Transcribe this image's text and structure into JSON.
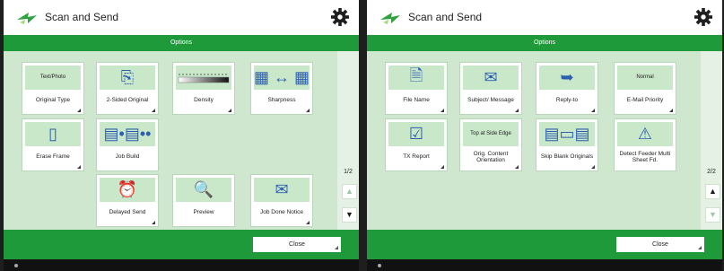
{
  "left": {
    "title": "Scan and Send",
    "options_label": "Options",
    "page": "1/2",
    "close_label": "Close",
    "tiles": [
      {
        "label": "Original Type",
        "icon_text": "Text/Photo"
      },
      {
        "label": "2-Sided Original",
        "icon_text": ""
      },
      {
        "label": "Density",
        "icon_text": ""
      },
      {
        "label": "Sharpness",
        "icon_text": ""
      },
      {
        "label": "Erase Frame",
        "icon_text": ""
      },
      {
        "label": "Job Build",
        "icon_text": ""
      },
      {
        "label": "Delayed Send",
        "icon_text": ""
      },
      {
        "label": "Preview",
        "icon_text": ""
      },
      {
        "label": "Job Done Notice",
        "icon_text": ""
      }
    ]
  },
  "right": {
    "title": "Scan and Send",
    "options_label": "Options",
    "page": "2/2",
    "close_label": "Close",
    "tiles": [
      {
        "label": "File Name",
        "icon_text": ""
      },
      {
        "label": "Subject/ Message",
        "icon_text": ""
      },
      {
        "label": "Reply-to",
        "icon_text": ""
      },
      {
        "label": "E-Mail Priority",
        "icon_text": "Normal"
      },
      {
        "label": "TX Report",
        "icon_text": ""
      },
      {
        "label": "Orig. Content Orientation",
        "icon_text": "Top at Side Edge"
      },
      {
        "label": "Skip Blank Originals",
        "icon_text": ""
      },
      {
        "label": "Detect Feeder Multi Sheet Fd.",
        "icon_text": ""
      }
    ]
  },
  "colors": {
    "accent": "#1e9a3a",
    "tile_area": "#cfe7cf"
  },
  "icons": {
    "title": "scan-send-icon",
    "settings": "gear-icon",
    "up": "scroll-up-icon",
    "down": "scroll-down-icon"
  }
}
